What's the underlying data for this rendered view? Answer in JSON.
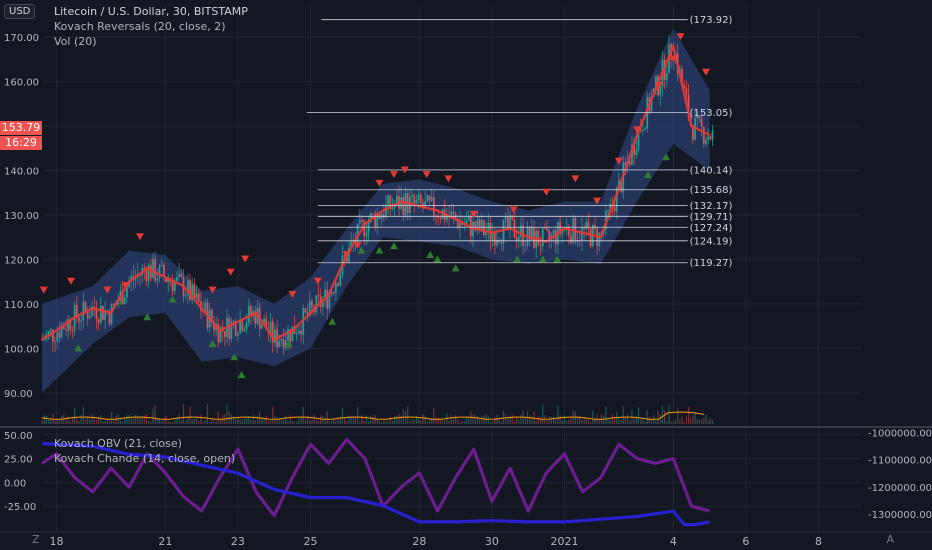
{
  "header": {
    "symbol_line": "Litecoin / U.S. Dollar, 30, BITSTAMP",
    "indicator_1": "Kovach Reversals (20, close, 2)",
    "indicator_2": "Vol (20)",
    "currency_badge": "USD",
    "price_badge": "153.79",
    "countdown_badge": "16:29"
  },
  "lower_pane": {
    "indicator_1": "Kovach OBV (21, close)",
    "indicator_2": "Kovach Chande (14, close, open)"
  },
  "footer": {
    "z_button": "Z",
    "a_button": "A"
  },
  "colors": {
    "background": "#131722",
    "up": "#26a69a",
    "down": "#ef5350",
    "ma": "#e53935",
    "band": "#2a3d6e",
    "obv": "#2622d1",
    "chande": "#7b1fa2",
    "volume_ma": "#ff9800"
  },
  "chart_data": [
    {
      "type": "line",
      "pane": "price",
      "ylim": [
        83,
        177
      ],
      "y_ticks": [
        "90.00",
        "100.00",
        "110.00",
        "120.00",
        "130.00",
        "140.00",
        "150.00",
        "160.00",
        "170.00"
      ],
      "x_tick_labels": [
        "18",
        "21",
        "23",
        "25",
        "28",
        "30",
        "2021",
        "4",
        "6",
        "8"
      ],
      "x_tick_positions_days": [
        0,
        3,
        5,
        7,
        10,
        12,
        14,
        17,
        19,
        21
      ],
      "x_range_days": [
        -0.4,
        22.2
      ],
      "level_labels": [
        "(173.92)",
        "(153.05)",
        "(140.14)",
        "(135.68)",
        "(132.17)",
        "(129.71)",
        "(127.24)",
        "(124.19)",
        "(119.27)"
      ],
      "levels": [
        173.92,
        153.05,
        140.14,
        135.68,
        132.17,
        129.71,
        127.24,
        124.19,
        119.27
      ],
      "series": [
        {
          "role": "moving-average",
          "x": [
            -0.4,
            0,
            0.5,
            1,
            1.5,
            2,
            2.5,
            3,
            3.5,
            4,
            4.5,
            5,
            5.5,
            6,
            6.5,
            7,
            7.5,
            8,
            8.5,
            9,
            9.5,
            10,
            10.5,
            11,
            11.5,
            12,
            12.5,
            13,
            13.5,
            14,
            14.5,
            15,
            15.5,
            16,
            16.5,
            17,
            17.5,
            18
          ],
          "y": [
            102,
            104,
            107,
            109,
            108,
            115,
            118,
            116,
            114,
            109,
            104,
            106,
            108,
            102,
            104,
            108,
            112,
            121,
            128,
            131,
            133,
            132,
            131,
            129,
            127,
            126,
            127,
            125,
            124,
            127,
            126,
            125,
            136,
            148,
            158,
            168,
            150,
            148
          ]
        },
        {
          "role": "band-upper",
          "x": [
            -0.4,
            1,
            2,
            3,
            4,
            5,
            6,
            7,
            8,
            9,
            10,
            11,
            12,
            13,
            14,
            15,
            16,
            17,
            18
          ],
          "y": [
            110,
            114,
            122,
            121,
            113,
            114,
            110,
            116,
            127,
            137,
            138,
            136,
            133,
            131,
            133,
            133,
            154,
            172,
            158
          ]
        },
        {
          "role": "band-lower",
          "x": [
            -0.4,
            1,
            2,
            3,
            4,
            5,
            6,
            7,
            8,
            9,
            10,
            11,
            12,
            13,
            14,
            15,
            16,
            17,
            18
          ],
          "y": [
            90,
            101,
            107,
            108,
            97,
            98,
            96,
            100,
            114,
            125,
            124,
            123,
            120,
            119,
            120,
            119,
            133,
            146,
            140
          ]
        },
        {
          "role": "reversal-down",
          "x": [
            -0.35,
            0.4,
            1.4,
            1.9,
            2.3,
            4.3,
            4.8,
            5.2,
            6.5,
            7.2,
            8.0,
            8.3,
            8.9,
            9.3,
            9.6,
            10.2,
            10.8,
            11.5,
            12.6,
            13.5,
            14.3,
            14.9,
            15.5,
            16.0,
            16.6,
            17.0,
            17.2,
            17.9
          ],
          "y": [
            113,
            115,
            113,
            114,
            125,
            113,
            117,
            120,
            112,
            115,
            121,
            123,
            137,
            139,
            140,
            139,
            138,
            130,
            131,
            135,
            138,
            133,
            142,
            149,
            159,
            165,
            170,
            162
          ]
        },
        {
          "role": "reversal-up",
          "x": [
            0.6,
            2.5,
            3.2,
            4.3,
            4.9,
            5.1,
            6.4,
            7.6,
            8.4,
            8.9,
            9.3,
            10.3,
            10.5,
            11.0,
            12.7,
            13.4,
            13.8,
            16.3,
            16.8
          ],
          "y": [
            100,
            107,
            111,
            101,
            98,
            94,
            101,
            106,
            122,
            122,
            123,
            121,
            120,
            118,
            120,
            120,
            120,
            139,
            143
          ]
        }
      ]
    },
    {
      "type": "line",
      "pane": "oscillator",
      "y_ticks_left": [
        "50.00",
        "25.00",
        "0.00",
        "-25.00"
      ],
      "y_ticks_right": [
        "-1000000.00",
        "-1100000.00",
        "-1200000.00",
        "-1300000.00"
      ],
      "left_ylim": [
        -50,
        55
      ],
      "right_ylim": [
        -1360000,
        -990000
      ],
      "series": [
        {
          "name": "Kovach OBV (21, close)",
          "axis": "right",
          "x": [
            -0.4,
            1,
            2,
            3,
            4,
            5,
            6,
            7,
            8,
            9,
            10,
            11,
            12,
            13,
            14,
            15,
            16,
            17,
            17.3,
            17.6,
            18
          ],
          "y": [
            -1040000,
            -1050000,
            -1080000,
            -1090000,
            -1120000,
            -1150000,
            -1210000,
            -1240000,
            -1240000,
            -1270000,
            -1330000,
            -1330000,
            -1325000,
            -1330000,
            -1330000,
            -1320000,
            -1310000,
            -1290000,
            -1340000,
            -1340000,
            -1330000
          ]
        },
        {
          "name": "Kovach Chande (14, close, open)",
          "axis": "left",
          "x": [
            -0.4,
            0,
            0.5,
            1,
            1.5,
            2,
            2.5,
            3,
            3.5,
            4,
            4.5,
            5,
            5.5,
            6,
            6.5,
            7,
            7.5,
            8,
            8.5,
            9,
            9.5,
            10,
            10.5,
            11,
            11.5,
            12,
            12.5,
            13,
            13.5,
            14,
            14.5,
            15,
            15.5,
            16,
            16.5,
            17,
            17.5,
            18
          ],
          "y": [
            20,
            30,
            5,
            -10,
            15,
            -5,
            30,
            10,
            -15,
            -30,
            5,
            35,
            -10,
            -35,
            5,
            40,
            20,
            45,
            25,
            -25,
            -5,
            10,
            -30,
            5,
            35,
            -20,
            15,
            -30,
            10,
            30,
            -10,
            5,
            40,
            25,
            20,
            25,
            -25,
            -30
          ]
        }
      ]
    }
  ]
}
